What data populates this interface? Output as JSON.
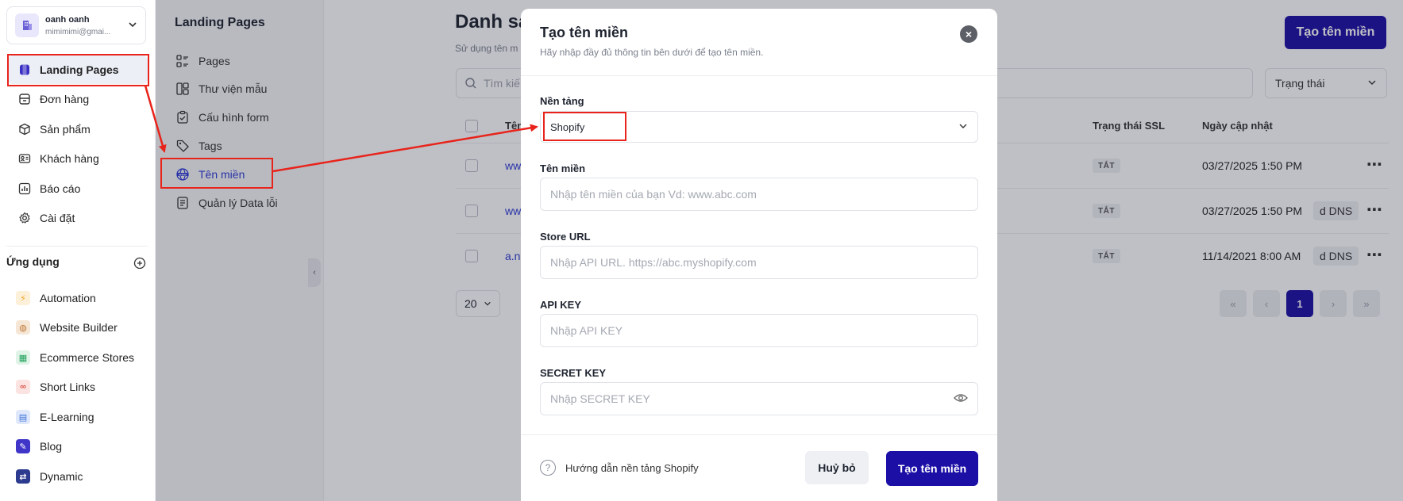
{
  "account": {
    "name": "oanh oanh",
    "email": "mimimimi@gmai..."
  },
  "nav": [
    {
      "label": "Landing Pages",
      "icon": "landing-pages-icon",
      "active": true
    },
    {
      "label": "Đơn hàng",
      "icon": "orders-icon"
    },
    {
      "label": "Sản phẩm",
      "icon": "box-icon"
    },
    {
      "label": "Khách hàng",
      "icon": "customer-card-icon"
    },
    {
      "label": "Báo cáo",
      "icon": "chart-icon"
    },
    {
      "label": "Cài đặt",
      "icon": "gear-icon"
    }
  ],
  "apps": {
    "title": "Ứng dụng",
    "items": [
      {
        "label": "Automation",
        "icon": "bolt-icon",
        "color": "#f4a11d"
      },
      {
        "label": "Website Builder",
        "icon": "globe-icon",
        "color": "#c07a3a"
      },
      {
        "label": "Ecommerce Stores",
        "icon": "store-icon",
        "color": "#1fa05a"
      },
      {
        "label": "Short Links",
        "icon": "link-icon",
        "color": "#e0564c"
      },
      {
        "label": "E-Learning",
        "icon": "book-icon",
        "color": "#3b6fd8"
      },
      {
        "label": "Blog",
        "icon": "pencil-icon",
        "color": "#3f35c9"
      },
      {
        "label": "Dynamic",
        "icon": "shuffle-icon",
        "color": "#2c3a8f"
      }
    ]
  },
  "subnav": {
    "title": "Landing Pages",
    "items": [
      {
        "label": "Pages",
        "icon": "pages-icon"
      },
      {
        "label": "Thư viện mẫu",
        "icon": "template-library-icon"
      },
      {
        "label": "Cấu hình form",
        "icon": "clipboard-icon"
      },
      {
        "label": "Tags",
        "icon": "tags-icon"
      },
      {
        "label": "Tên miền",
        "icon": "www-globe-icon",
        "active": true
      },
      {
        "label": "Quản lý Data lỗi",
        "icon": "document-list-icon"
      }
    ]
  },
  "main": {
    "title": "Danh sá",
    "subtitle": "Sử dụng tên m",
    "create_button": "Tạo tên miền",
    "search_placeholder": "Tìm kiế",
    "status_filter": "Trạng thái",
    "columns": {
      "name": "Tên",
      "ssl": "Trạng thái SSL",
      "updated": "Ngày cập nhật"
    },
    "rows": [
      {
        "name": "ww",
        "dns": "",
        "ssl": "TẮT",
        "updated": "03/27/2025 1:50 PM"
      },
      {
        "name": "ww",
        "dns": "d DNS",
        "ssl": "TẮT",
        "updated": "03/27/2025 1:50 PM"
      },
      {
        "name": "a.n",
        "dns": "d DNS",
        "ssl": "TẮT",
        "updated": "11/14/2021 8:00 AM"
      }
    ],
    "page_size": "20",
    "current_page": "1"
  },
  "modal": {
    "title": "Tạo tên miền",
    "subtitle": "Hãy nhập đầy đủ thông tin bên dưới để tạo tên miền.",
    "platform_label": "Nền tảng",
    "platform_value": "Shopify",
    "domain_label": "Tên miền",
    "domain_placeholder": "Nhập tên miền của bạn Vd: www.abc.com",
    "store_url_label": "Store URL",
    "store_url_placeholder": "Nhập API URL. https://abc.myshopify.com",
    "api_key_label": "API KEY",
    "api_key_placeholder": "Nhập API KEY",
    "secret_key_label": "SECRET KEY",
    "secret_key_placeholder": "Nhập SECRET KEY",
    "help_text": "Hướng dẫn nền tảng Shopify",
    "cancel_label": "Huỷ bỏ",
    "submit_label": "Tạo tên miền"
  },
  "colors": {
    "primary": "#1c0fa6",
    "annotation": "#e8231b",
    "active_link": "#2f3bd6"
  }
}
